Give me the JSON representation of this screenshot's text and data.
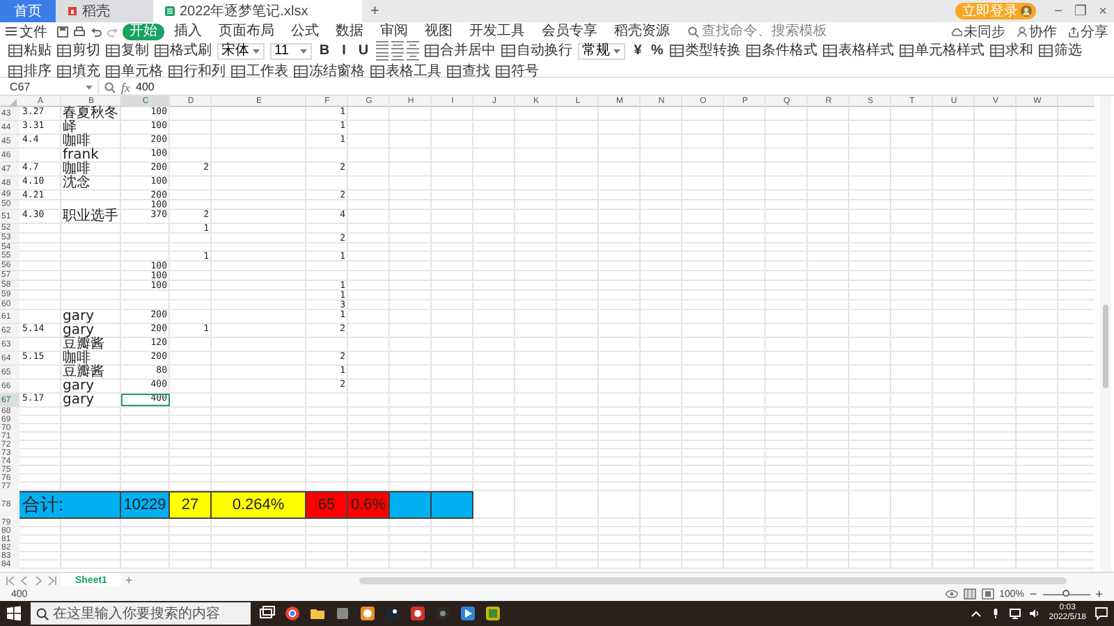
{
  "tabs": [
    {
      "kind": "home",
      "label": "首页",
      "selected": false
    },
    {
      "kind": "docer",
      "label": "稻壳",
      "selected": false
    },
    {
      "kind": "file",
      "label": "2022年逐梦笔记.xlsx",
      "selected": true
    }
  ],
  "new_tab": "+",
  "login": "立即登录",
  "window_controls": [
    "−",
    "❐",
    "×"
  ],
  "menu": {
    "file": "文件",
    "items": [
      {
        "label": "开始",
        "selected": true
      },
      {
        "label": "插入",
        "selected": false
      },
      {
        "label": "页面布局",
        "selected": false
      },
      {
        "label": "公式",
        "selected": false
      },
      {
        "label": "数据",
        "selected": false
      },
      {
        "label": "审阅",
        "selected": false
      },
      {
        "label": "视图",
        "selected": false
      },
      {
        "label": "开发工具",
        "selected": false
      },
      {
        "label": "会员专享",
        "selected": false
      },
      {
        "label": "稻壳资源",
        "selected": false
      }
    ],
    "search_placeholder": "查找命令、搜索模板",
    "actions": [
      "未同步",
      "协作",
      "分享"
    ]
  },
  "toolbar": [
    {
      "kind": "button",
      "label": "粘贴"
    },
    {
      "kind": "button",
      "label": "剪切"
    },
    {
      "kind": "button",
      "label": "复制"
    },
    {
      "kind": "button",
      "label": "格式刷"
    },
    {
      "kind": "select",
      "value": "宋体"
    },
    {
      "kind": "select",
      "value": "11"
    },
    {
      "kind": "char",
      "label": "B"
    },
    {
      "kind": "char",
      "label": "I"
    },
    {
      "kind": "char",
      "label": "U"
    },
    {
      "kind": "button",
      "label": "合并居中"
    },
    {
      "kind": "button",
      "label": "自动换行"
    },
    {
      "kind": "select",
      "value": "常规"
    },
    {
      "kind": "char",
      "label": "¥"
    },
    {
      "kind": "char",
      "label": "%"
    },
    {
      "kind": "button",
      "label": "类型转换"
    },
    {
      "kind": "button",
      "label": "条件格式"
    },
    {
      "kind": "button",
      "label": "表格样式"
    },
    {
      "kind": "button",
      "label": "单元格样式"
    },
    {
      "kind": "button",
      "label": "求和"
    },
    {
      "kind": "button",
      "label": "筛选"
    },
    {
      "kind": "button",
      "label": "排序"
    },
    {
      "kind": "button",
      "label": "填充"
    },
    {
      "kind": "button",
      "label": "单元格"
    },
    {
      "kind": "button",
      "label": "行和列"
    },
    {
      "kind": "button",
      "label": "工作表"
    },
    {
      "kind": "button",
      "label": "冻结窗格"
    },
    {
      "kind": "button",
      "label": "表格工具"
    },
    {
      "kind": "button",
      "label": "查找"
    },
    {
      "kind": "button",
      "label": "符号"
    }
  ],
  "formula_bar": {
    "cell": "C67",
    "fx": "fx",
    "value": "400"
  },
  "sheet": {
    "columns": [
      {
        "label": "A",
        "selected": false
      },
      {
        "label": "B",
        "selected": false
      },
      {
        "label": "C",
        "selected": true
      },
      {
        "label": "D",
        "selected": false
      },
      {
        "label": "E",
        "selected": false
      },
      {
        "label": "F",
        "selected": false
      },
      {
        "label": "G",
        "selected": false
      },
      {
        "label": "H",
        "selected": false
      },
      {
        "label": "I",
        "selected": false
      },
      {
        "label": "J",
        "selected": false
      },
      {
        "label": "K",
        "selected": false
      },
      {
        "label": "L",
        "selected": false
      },
      {
        "label": "M",
        "selected": false
      },
      {
        "label": "N",
        "selected": false
      },
      {
        "label": "O",
        "selected": false
      },
      {
        "label": "P",
        "selected": false
      },
      {
        "label": "Q",
        "selected": false
      },
      {
        "label": "R",
        "selected": false
      },
      {
        "label": "S",
        "selected": false
      },
      {
        "label": "T",
        "selected": false
      },
      {
        "label": "U",
        "selected": false
      },
      {
        "label": "V",
        "selected": false
      },
      {
        "label": "W",
        "selected": false
      }
    ],
    "rows": [
      {
        "kind": "data",
        "number": "43",
        "selected": false,
        "cells": [
          "3.27",
          "春夏秋冬",
          "100",
          null,
          null,
          "1"
        ]
      },
      {
        "kind": "data",
        "number": "44",
        "selected": false,
        "cells": [
          "3.31",
          "峄",
          "100",
          null,
          null,
          "1"
        ]
      },
      {
        "kind": "data",
        "number": "45",
        "selected": false,
        "cells": [
          "4.4",
          "咖啡",
          "200",
          null,
          null,
          "1"
        ]
      },
      {
        "kind": "data",
        "number": "46",
        "selected": false,
        "cells": [
          null,
          "frank",
          "100"
        ]
      },
      {
        "kind": "data",
        "number": "47",
        "selected": false,
        "cells": [
          "4.7",
          "咖啡",
          "200",
          "2",
          null,
          "2"
        ]
      },
      {
        "kind": "data",
        "number": "48",
        "selected": false,
        "cells": [
          "4.10",
          "沈念",
          "100"
        ]
      },
      {
        "kind": "data",
        "number": "49",
        "selected": false,
        "cells": [
          "4.21",
          null,
          "200",
          null,
          null,
          "2"
        ]
      },
      {
        "kind": "data",
        "number": "50",
        "selected": false,
        "cells": [
          null,
          null,
          "100"
        ]
      },
      {
        "kind": "data",
        "number": "51",
        "selected": false,
        "cells": [
          "4.30",
          "职业选手",
          "370",
          "2",
          null,
          "4"
        ]
      },
      {
        "kind": "data",
        "number": "52",
        "selected": false,
        "cells": [
          null,
          null,
          null,
          "1"
        ]
      },
      {
        "kind": "data",
        "number": "53",
        "selected": false,
        "cells": [
          null,
          null,
          null,
          null,
          null,
          "2"
        ]
      },
      {
        "kind": "data",
        "number": "54",
        "selected": false
      },
      {
        "kind": "data",
        "number": "55",
        "selected": false,
        "cells": [
          null,
          null,
          null,
          "1",
          null,
          "1"
        ]
      },
      {
        "kind": "data",
        "number": "56",
        "selected": false,
        "cells": [
          null,
          null,
          "100"
        ]
      },
      {
        "kind": "data",
        "number": "57",
        "selected": false,
        "cells": [
          null,
          null,
          "100"
        ]
      },
      {
        "kind": "data",
        "number": "58",
        "selected": false,
        "cells": [
          null,
          null,
          "100",
          null,
          null,
          "1"
        ]
      },
      {
        "kind": "data",
        "number": "59",
        "selected": false,
        "cells": [
          null,
          null,
          null,
          null,
          null,
          "1"
        ]
      },
      {
        "kind": "data",
        "number": "60",
        "selected": false,
        "cells": [
          null,
          null,
          null,
          null,
          null,
          "3"
        ]
      },
      {
        "kind": "data",
        "number": "61",
        "selected": false,
        "cells": [
          null,
          "gary",
          "200",
          null,
          null,
          "1"
        ]
      },
      {
        "kind": "data",
        "number": "62",
        "selected": false,
        "cells": [
          "5.14",
          "gary",
          "200",
          "1",
          null,
          "2"
        ]
      },
      {
        "kind": "data",
        "number": "63",
        "selected": false,
        "cells": [
          null,
          "豆瓣酱",
          "120"
        ]
      },
      {
        "kind": "data",
        "number": "64",
        "selected": false,
        "cells": [
          "5.15",
          "咖啡",
          "200",
          null,
          null,
          "2"
        ]
      },
      {
        "kind": "data",
        "number": "65",
        "selected": false,
        "cells": [
          null,
          "豆瓣酱",
          "80",
          null,
          null,
          "1"
        ]
      },
      {
        "kind": "data",
        "number": "66",
        "selected": false,
        "cells": [
          null,
          "gary",
          "400",
          null,
          null,
          "2"
        ]
      },
      {
        "kind": "data",
        "number": "67",
        "selected": true,
        "cells": [
          "5.17",
          "gary",
          "400"
        ]
      },
      {
        "kind": "data",
        "number": "68",
        "selected": false
      },
      {
        "kind": "data",
        "number": "69",
        "selected": false
      },
      {
        "kind": "data",
        "number": "70",
        "selected": false
      },
      {
        "kind": "data",
        "number": "71",
        "selected": false
      },
      {
        "kind": "data",
        "number": "72",
        "selected": false
      },
      {
        "kind": "data",
        "number": "73",
        "selected": false
      },
      {
        "kind": "data",
        "number": "74",
        "selected": false
      },
      {
        "kind": "data",
        "number": "75",
        "selected": false
      },
      {
        "kind": "data",
        "number": "76",
        "selected": false
      },
      {
        "kind": "data",
        "number": "77",
        "selected": false
      },
      {
        "kind": "total",
        "number": "78",
        "selected": false,
        "cells": [
          {
            "text": "合计:",
            "color": "#00b0f0",
            "merged": true
          },
          null,
          {
            "text": "10229",
            "color": "#00b0f0"
          },
          {
            "text": "27",
            "color": "#ffff00"
          },
          {
            "text": "0.264%",
            "color": "#ffff00"
          },
          {
            "text": "65",
            "color": "#ff0000"
          },
          {
            "text": "0.6%",
            "color": "#ff0000"
          },
          {
            "color": "#00b0f0"
          },
          {
            "color": "#00b0f0"
          }
        ]
      },
      {
        "kind": "data",
        "number": "79",
        "selected": false
      },
      {
        "kind": "data",
        "number": "80",
        "selected": false
      },
      {
        "kind": "data",
        "number": "81",
        "selected": false
      },
      {
        "kind": "data",
        "number": "82",
        "selected": false
      },
      {
        "kind": "data",
        "number": "83",
        "selected": false
      },
      {
        "kind": "data",
        "number": "84",
        "selected": false
      }
    ]
  },
  "sheet_tabs": [
    {
      "label": "Sheet1",
      "selected": true
    }
  ],
  "add_sheet": "+",
  "status_bar": {
    "value": "400",
    "zoom": "100%",
    "zoom_out": "−",
    "zoom_in": "+",
    "level": 0.5
  },
  "taskbar": {
    "search_placeholder": "在这里输入你要搜索的内容",
    "time": "0:03",
    "date": "2022/5/18"
  }
}
